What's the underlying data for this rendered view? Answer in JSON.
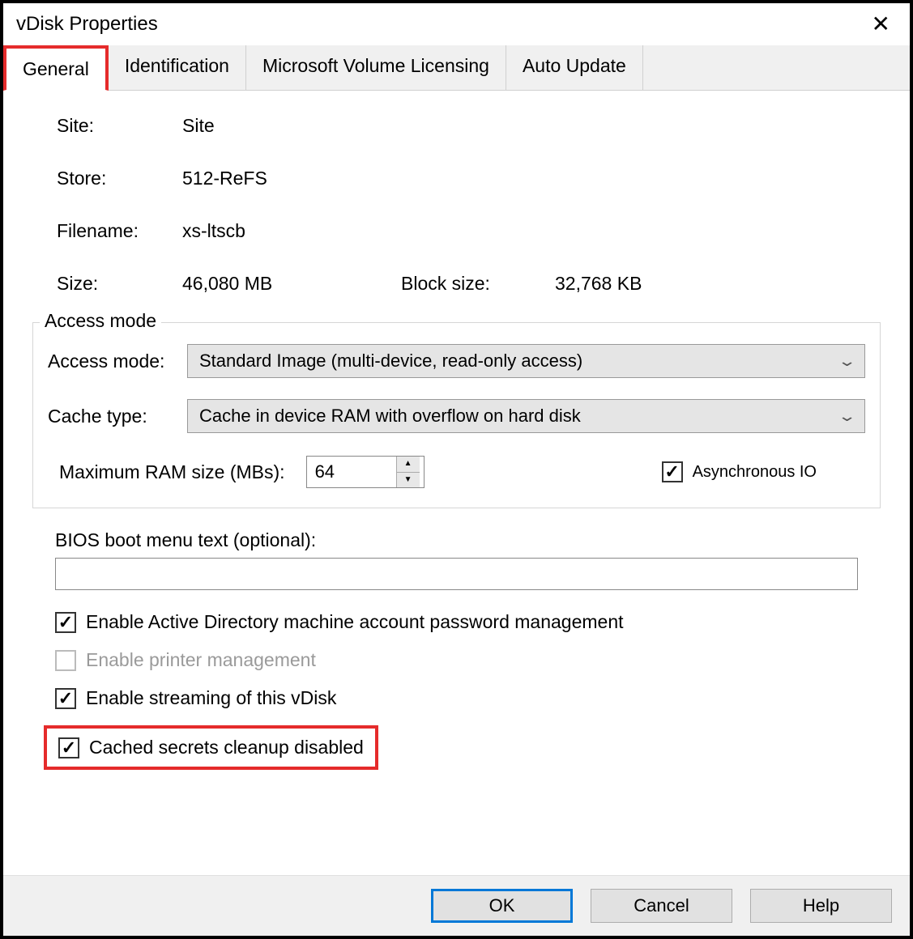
{
  "window": {
    "title": "vDisk Properties"
  },
  "tabs": [
    {
      "label": "General",
      "active": true
    },
    {
      "label": "Identification",
      "active": false
    },
    {
      "label": "Microsoft Volume Licensing",
      "active": false
    },
    {
      "label": "Auto Update",
      "active": false
    }
  ],
  "info": {
    "site_label": "Site:",
    "site_value": "Site",
    "store_label": "Store:",
    "store_value": "512-ReFS",
    "filename_label": "Filename:",
    "filename_value": "xs-ltscb",
    "size_label": "Size:",
    "size_value": "46,080 MB",
    "block_label": "Block size:",
    "block_value": "32,768 KB"
  },
  "access": {
    "legend": "Access mode",
    "mode_label": "Access mode:",
    "mode_value": "Standard Image (multi-device, read-only access)",
    "cache_label": "Cache type:",
    "cache_value": "Cache in device RAM with overflow on hard disk",
    "ram_label": "Maximum RAM size (MBs):",
    "ram_value": "64",
    "async_label": "Asynchronous IO",
    "async_checked": true
  },
  "bios": {
    "label": "BIOS boot menu text (optional):",
    "value": ""
  },
  "checks": {
    "ad": {
      "label": "Enable Active Directory machine account password management",
      "checked": true,
      "disabled": false
    },
    "printer": {
      "label": "Enable printer management",
      "checked": false,
      "disabled": true
    },
    "streaming": {
      "label": "Enable streaming of this vDisk",
      "checked": true,
      "disabled": false
    },
    "cached": {
      "label": "Cached secrets cleanup disabled",
      "checked": true,
      "disabled": false
    }
  },
  "buttons": {
    "ok": "OK",
    "cancel": "Cancel",
    "help": "Help"
  }
}
